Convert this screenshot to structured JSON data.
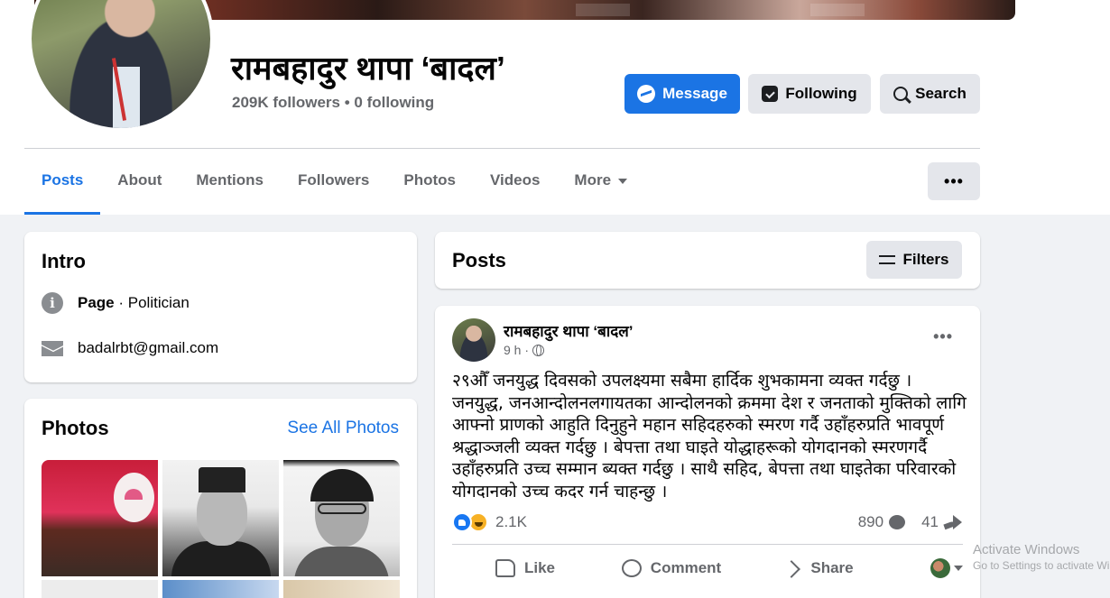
{
  "profile": {
    "name": "रामबहादुर थापा ‘बादल’",
    "stats": "209K followers • 0 following"
  },
  "actions": {
    "message": "Message",
    "following": "Following",
    "search": "Search",
    "more_dots": "•••"
  },
  "tabs": [
    {
      "label": "Posts",
      "active": true
    },
    {
      "label": "About"
    },
    {
      "label": "Mentions"
    },
    {
      "label": "Followers"
    },
    {
      "label": "Photos"
    },
    {
      "label": "Videos"
    },
    {
      "label": "More"
    }
  ],
  "intro": {
    "title": "Intro",
    "category_bold": "Page",
    "category_rest": " · Politician",
    "email": "badalrbt@gmail.com"
  },
  "photos": {
    "title": "Photos",
    "see_all": "See All Photos"
  },
  "posts_section": {
    "title": "Posts",
    "filters": "Filters"
  },
  "post": {
    "author": "रामबहादुर थापा ‘बादल’",
    "time": "9 h ·",
    "more": "•••",
    "text": "२९औँ जनयुद्ध दिवसको उपलक्ष्यमा सबैमा हार्दिक शुभकामना व्यक्त गर्दछु । जनयुद्ध, जनआन्दोलनलगायतका आन्दोलनको क्रममा देश र जनताको मुक्तिको लागि आफ्नो प्राणको आहुति दिनुहुने महान सहिदहरुको स्मरण गर्दै उहाँहरुप्रति भावपूर्ण श्रद्धाञ्जली व्यक्त गर्दछु ।  बेपत्ता तथा घाइते  योद्धाहरूको योगदानको स्मरणगर्दै उहाँहरुप्रति उच्च सम्मान ब्यक्त गर्दछु । साथै सहिद, बेपत्ता तथा घाइतेका परिवारको योगदानको उच्च कदर गर्न चाहन्छु ।",
    "reactions_count": "2.1K",
    "comments_count": "890",
    "shares_count": "41",
    "like_label": "Like",
    "comment_label": "Comment",
    "share_label": "Share"
  },
  "watermark": {
    "title": "Activate Windows",
    "subtitle": "Go to Settings to activate Windows."
  },
  "colors": {
    "accent": "#1b74e4",
    "secondary_button": "#e4e6eb",
    "page_bg": "#f0f2f5",
    "muted_text": "#65676b"
  },
  "icons": [
    "messenger-icon",
    "following-icon",
    "search-icon",
    "filter-icon",
    "info-icon",
    "mail-icon",
    "globe-icon",
    "like-icon",
    "comment-icon",
    "share-icon"
  ]
}
